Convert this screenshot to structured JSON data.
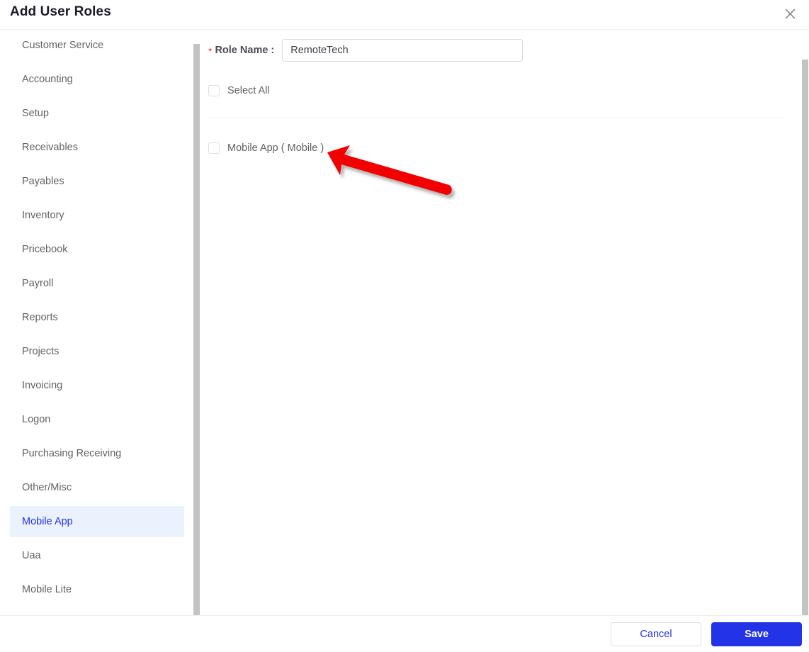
{
  "header": {
    "title": "Add User Roles",
    "close_icon": "close-icon"
  },
  "sidebar": {
    "items": [
      {
        "label": "Customer Service",
        "active": false
      },
      {
        "label": "Accounting",
        "active": false
      },
      {
        "label": "Setup",
        "active": false
      },
      {
        "label": "Receivables",
        "active": false
      },
      {
        "label": "Payables",
        "active": false
      },
      {
        "label": "Inventory",
        "active": false
      },
      {
        "label": "Pricebook",
        "active": false
      },
      {
        "label": "Payroll",
        "active": false
      },
      {
        "label": "Reports",
        "active": false
      },
      {
        "label": "Projects",
        "active": false
      },
      {
        "label": "Invoicing",
        "active": false
      },
      {
        "label": "Logon",
        "active": false
      },
      {
        "label": "Purchasing Receiving",
        "active": false
      },
      {
        "label": "Other/Misc",
        "active": false
      },
      {
        "label": "Mobile App",
        "active": true
      },
      {
        "label": "Uaa",
        "active": false
      },
      {
        "label": "Mobile Lite",
        "active": false
      }
    ],
    "active_item": "Mobile App"
  },
  "form": {
    "required_marker": "*",
    "role_name_label": "Role Name :",
    "role_name_value": "RemoteTech",
    "role_name_placeholder": "",
    "select_all_label": "Select All",
    "select_all_checked": false,
    "permissions": [
      {
        "label": "Mobile App ( Mobile )",
        "checked": false
      }
    ]
  },
  "footer": {
    "cancel_label": "Cancel",
    "save_label": "Save"
  },
  "colors": {
    "accent": "#2233E8",
    "active_item_bg": "#ECF1FE",
    "required_star": "#E8413A",
    "annotation_arrow": "#F20000",
    "text_primary": "#606266",
    "scrollbar": "#C3C3C3"
  },
  "annotation": {
    "type": "arrow",
    "color": "#F20000",
    "points_to": "Mobile App ( Mobile )"
  }
}
